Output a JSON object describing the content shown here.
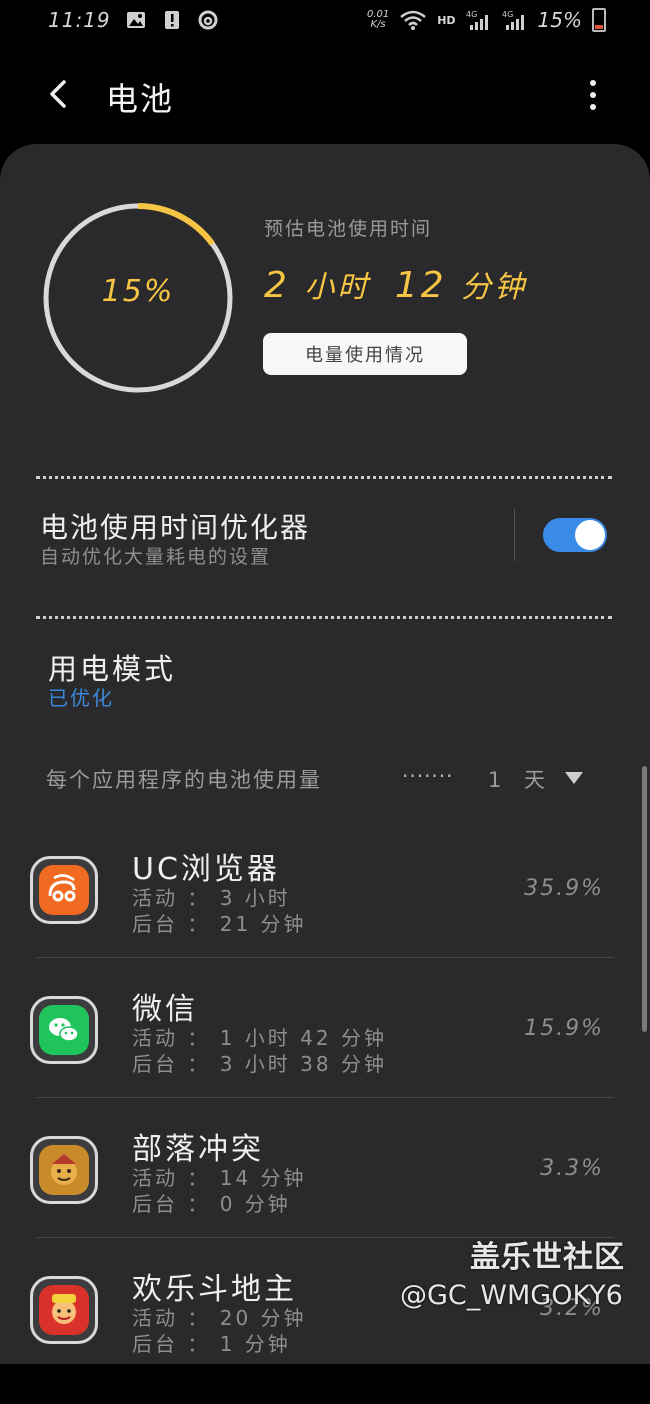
{
  "status_bar": {
    "time": "11:19",
    "net_speed_value": "0.01",
    "net_speed_unit": "K/s",
    "hd": "HD",
    "battery_pct": "15%"
  },
  "header": {
    "title": "电池"
  },
  "battery": {
    "level_label": "15%",
    "level_fraction": 0.15,
    "ring_color": "#f6c544",
    "estimate_label": "预估电池使用时间",
    "estimate_hours": "2",
    "hours_unit": "小时",
    "estimate_minutes": "12",
    "minutes_unit": "分钟",
    "usage_button": "电量使用情况"
  },
  "optimizer": {
    "title": "电池使用时间优化器",
    "subtitle": "自动优化大量耗电的设置",
    "enabled": true
  },
  "power_mode": {
    "title": "用电模式",
    "value": "已优化"
  },
  "per_app": {
    "label": "每个应用程序的电池使用量",
    "dots": "·······",
    "period": "1 天"
  },
  "apps": [
    {
      "name": "UC浏览器",
      "active": "活动 ： 3 小时",
      "background": "后台 ： 21 分钟",
      "percent": "35.9%",
      "icon": "uc-browser-icon"
    },
    {
      "name": "微信",
      "active": "活动 ： 1 小时 42 分钟",
      "background": "后台 ： 3 小时 38 分钟",
      "percent": "15.9%",
      "icon": "wechat-icon"
    },
    {
      "name": "部落冲突",
      "active": "活动 ： 14 分钟",
      "background": "后台 ： 0 分钟",
      "percent": "3.3%",
      "icon": "clash-of-clans-icon"
    },
    {
      "name": "欢乐斗地主",
      "active": "活动 ： 20 分钟",
      "background": "后台 ： 1 分钟",
      "percent": "3.2%",
      "icon": "doudizhu-icon"
    }
  ],
  "watermark": {
    "line1": "盖乐世社区",
    "line2": "@GC_WMGOKY6"
  }
}
